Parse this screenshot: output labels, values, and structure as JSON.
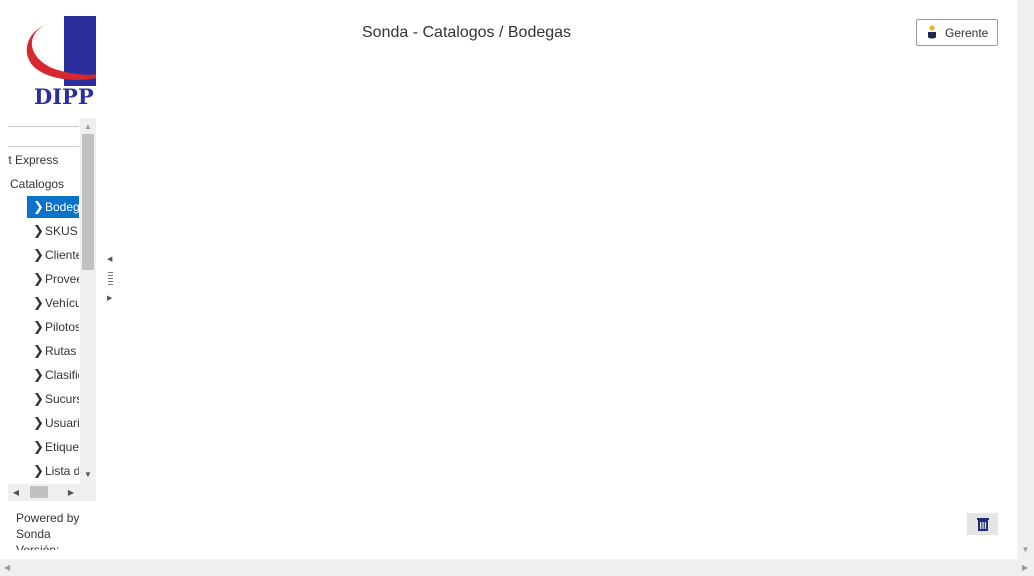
{
  "brand": {
    "logo_text": "DIPP"
  },
  "header": {
    "title": "Sonda - Catalogos / Bodegas"
  },
  "user_menu": {
    "label": "Gerente",
    "icon": "user-icon"
  },
  "sidebar": {
    "top_item": "ft Express",
    "section": "Catalogos",
    "items": [
      {
        "label": "Bodegas",
        "active": true
      },
      {
        "label": "SKUS"
      },
      {
        "label": "Clientes"
      },
      {
        "label": "Proveedores"
      },
      {
        "label": "Vehículos"
      },
      {
        "label": "Pilotos"
      },
      {
        "label": "Rutas"
      },
      {
        "label": "Clasificaciones"
      },
      {
        "label": "Sucursales"
      },
      {
        "label": "Usuarios"
      },
      {
        "label": "Etiquetas"
      },
      {
        "label": "Lista de"
      }
    ]
  },
  "footer": {
    "powered_by": "Powered by",
    "brand": "Sonda",
    "version_label": "Versión:"
  },
  "actions": {
    "delete_icon": "trash-icon"
  },
  "colors": {
    "active_bg": "#0a73c9",
    "logo_blue": "#2b2f9e",
    "logo_red": "#d7282f"
  }
}
